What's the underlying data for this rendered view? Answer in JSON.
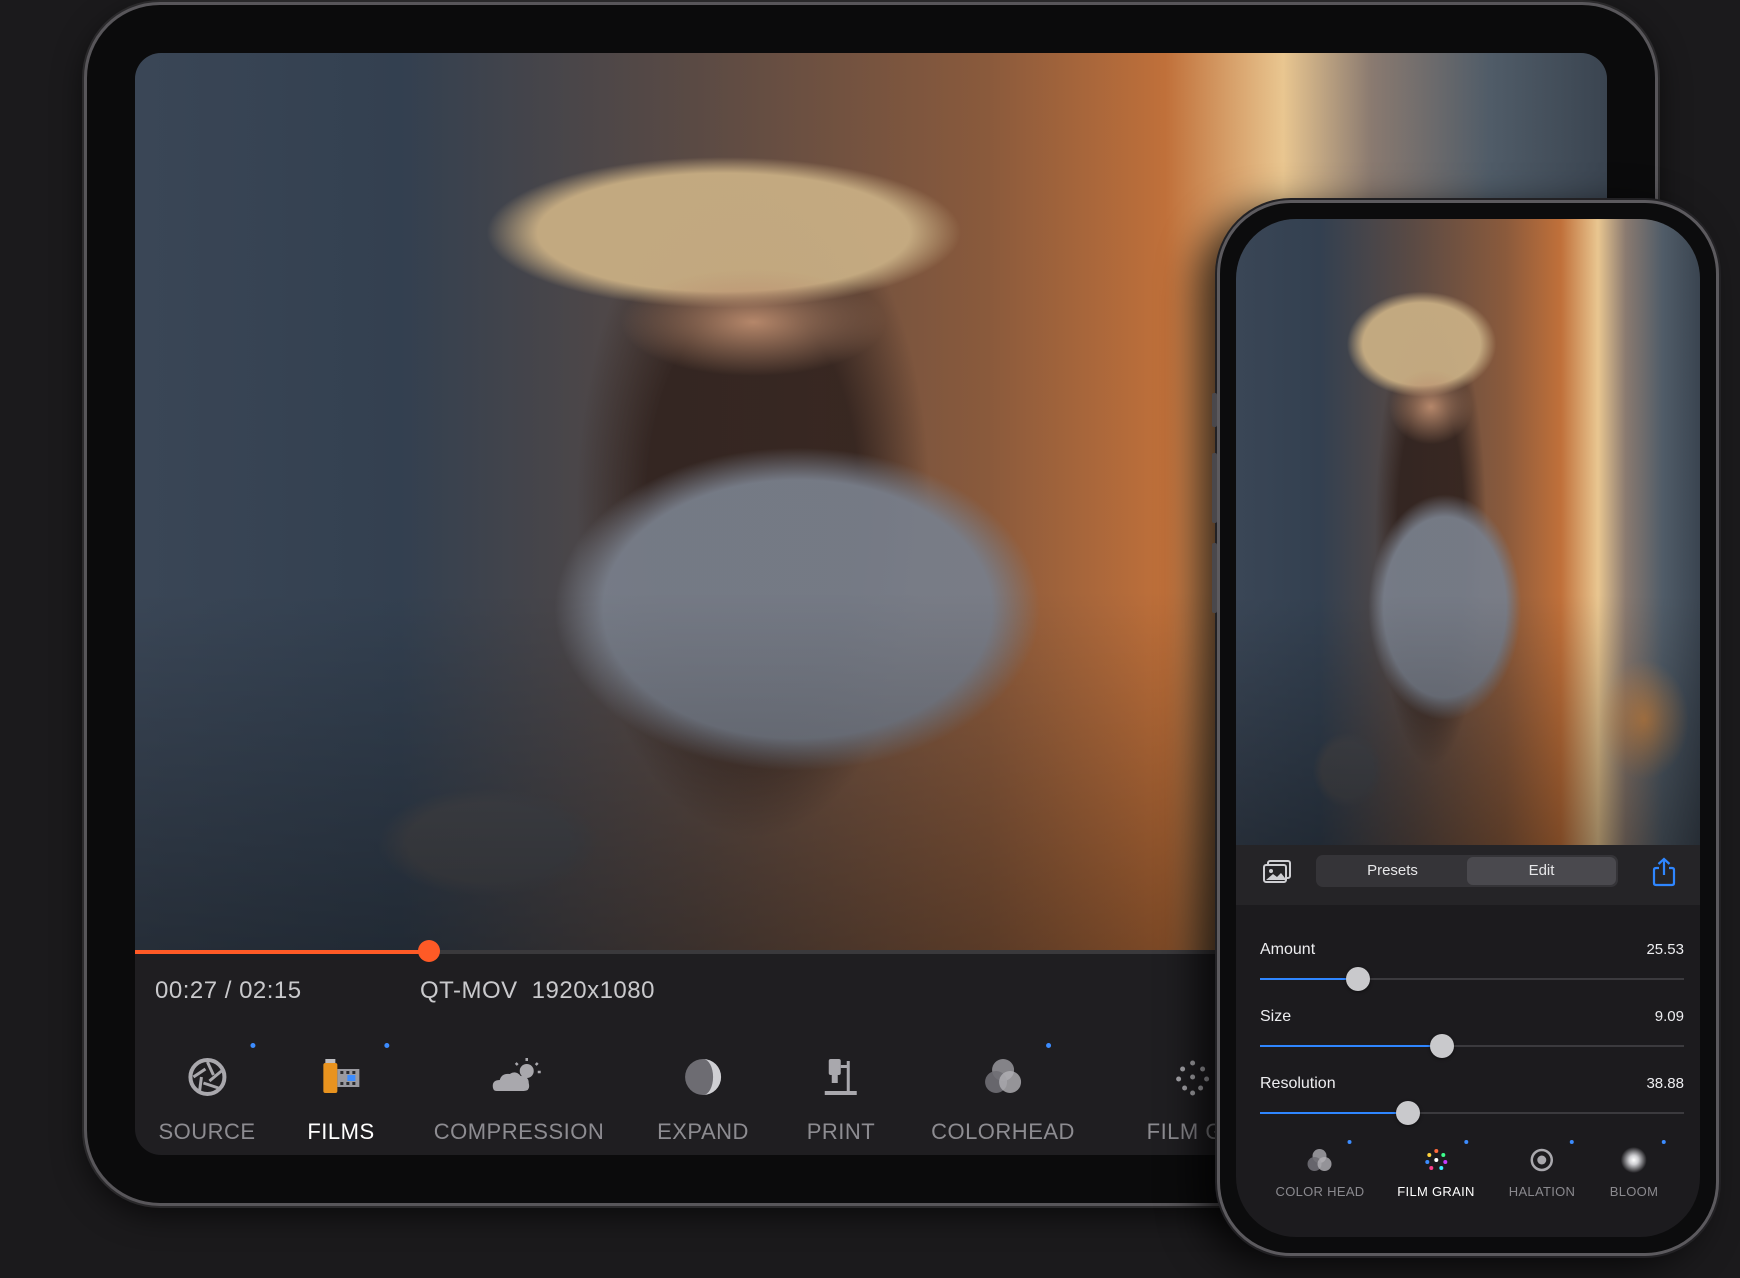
{
  "tablet": {
    "timecode": "00:27 / 02:15",
    "format": "QT-MOV",
    "resolution": "1920x1080",
    "playback_progress": 0.2,
    "accent_color": "#ff5a26",
    "tools": [
      {
        "label": "SOURCE",
        "icon": "aperture-icon",
        "active": false,
        "dot": true
      },
      {
        "label": "FILMS",
        "icon": "film-canister-icon",
        "active": true,
        "dot": true
      },
      {
        "label": "COMPRESSION",
        "icon": "weather-icon",
        "active": false,
        "dot": false
      },
      {
        "label": "EXPAND",
        "icon": "sphere-icon",
        "active": false,
        "dot": false
      },
      {
        "label": "PRINT",
        "icon": "enlarger-icon",
        "active": false,
        "dot": false
      },
      {
        "label": "COLORHEAD",
        "icon": "color-circles-icon",
        "active": false,
        "dot": true
      },
      {
        "label": "FILM GR",
        "icon": "grain-dots-icon",
        "active": false,
        "dot": false
      }
    ]
  },
  "phone": {
    "tabs": {
      "presets": "Presets",
      "edit": "Edit",
      "selected": "edit"
    },
    "sliders": [
      {
        "label": "Amount",
        "value": "25.53",
        "level": 0.23
      },
      {
        "label": "Size",
        "value": "9.09",
        "level": 0.43
      },
      {
        "label": "Resolution",
        "value": "38.88",
        "level": 0.35
      }
    ],
    "slider_color": "#2f86ff",
    "tools": [
      {
        "label": "COLOR HEAD",
        "icon": "color-circles-icon",
        "active": false,
        "dot": true
      },
      {
        "label": "FILM GRAIN",
        "icon": "grain-dots-icon",
        "active": true,
        "dot": true
      },
      {
        "label": "HALATION",
        "icon": "halation-ring-icon",
        "active": false,
        "dot": true
      },
      {
        "label": "BLOOM",
        "icon": "bloom-glow-icon",
        "active": false,
        "dot": true
      }
    ]
  }
}
